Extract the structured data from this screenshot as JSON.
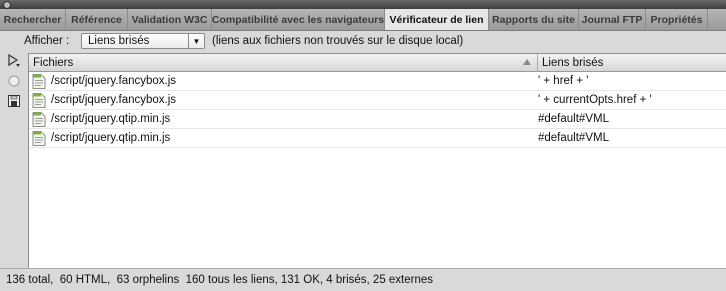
{
  "tabs": [
    {
      "label": "Rechercher"
    },
    {
      "label": "Référence"
    },
    {
      "label": "Validation W3C"
    },
    {
      "label": "Compatibilité avec les navigateurs"
    },
    {
      "label": "Vérificateur de lien",
      "active": true
    },
    {
      "label": "Rapports du site"
    },
    {
      "label": "Journal FTP"
    },
    {
      "label": "Propriétés"
    }
  ],
  "toolbar": {
    "show_label": "Afficher :",
    "show_value": "Liens brisés",
    "hint": "(liens aux fichiers non trouvés sur le disque local)"
  },
  "table": {
    "columns": [
      "Fichiers",
      "Liens brisés"
    ],
    "rows": [
      {
        "file": "/script/jquery.fancybox.js",
        "broken": "' + href + '"
      },
      {
        "file": "/script/jquery.fancybox.js",
        "broken": "' + currentOpts.href + '"
      },
      {
        "file": "/script/jquery.qtip.min.js",
        "broken": "#default#VML"
      },
      {
        "file": "/script/jquery.qtip.min.js",
        "broken": "#default#VML"
      }
    ]
  },
  "status": {
    "summary": "136 total,  60 HTML,  63 orphelins  160 tous les liens, 131 OK, 4 brisés, 25 externes"
  },
  "colors": {
    "active_tab": "#e6e6e6",
    "tab_bar": "#a8a8a8",
    "panel_background": "#ffffff",
    "file_icon": "#7fae3c"
  },
  "icons": {
    "left_tools": [
      "play-dropdown-icon",
      "circle-icon",
      "save-report-icon"
    ],
    "row": "js-file-icon",
    "sort": "sort-ascending-icon"
  }
}
